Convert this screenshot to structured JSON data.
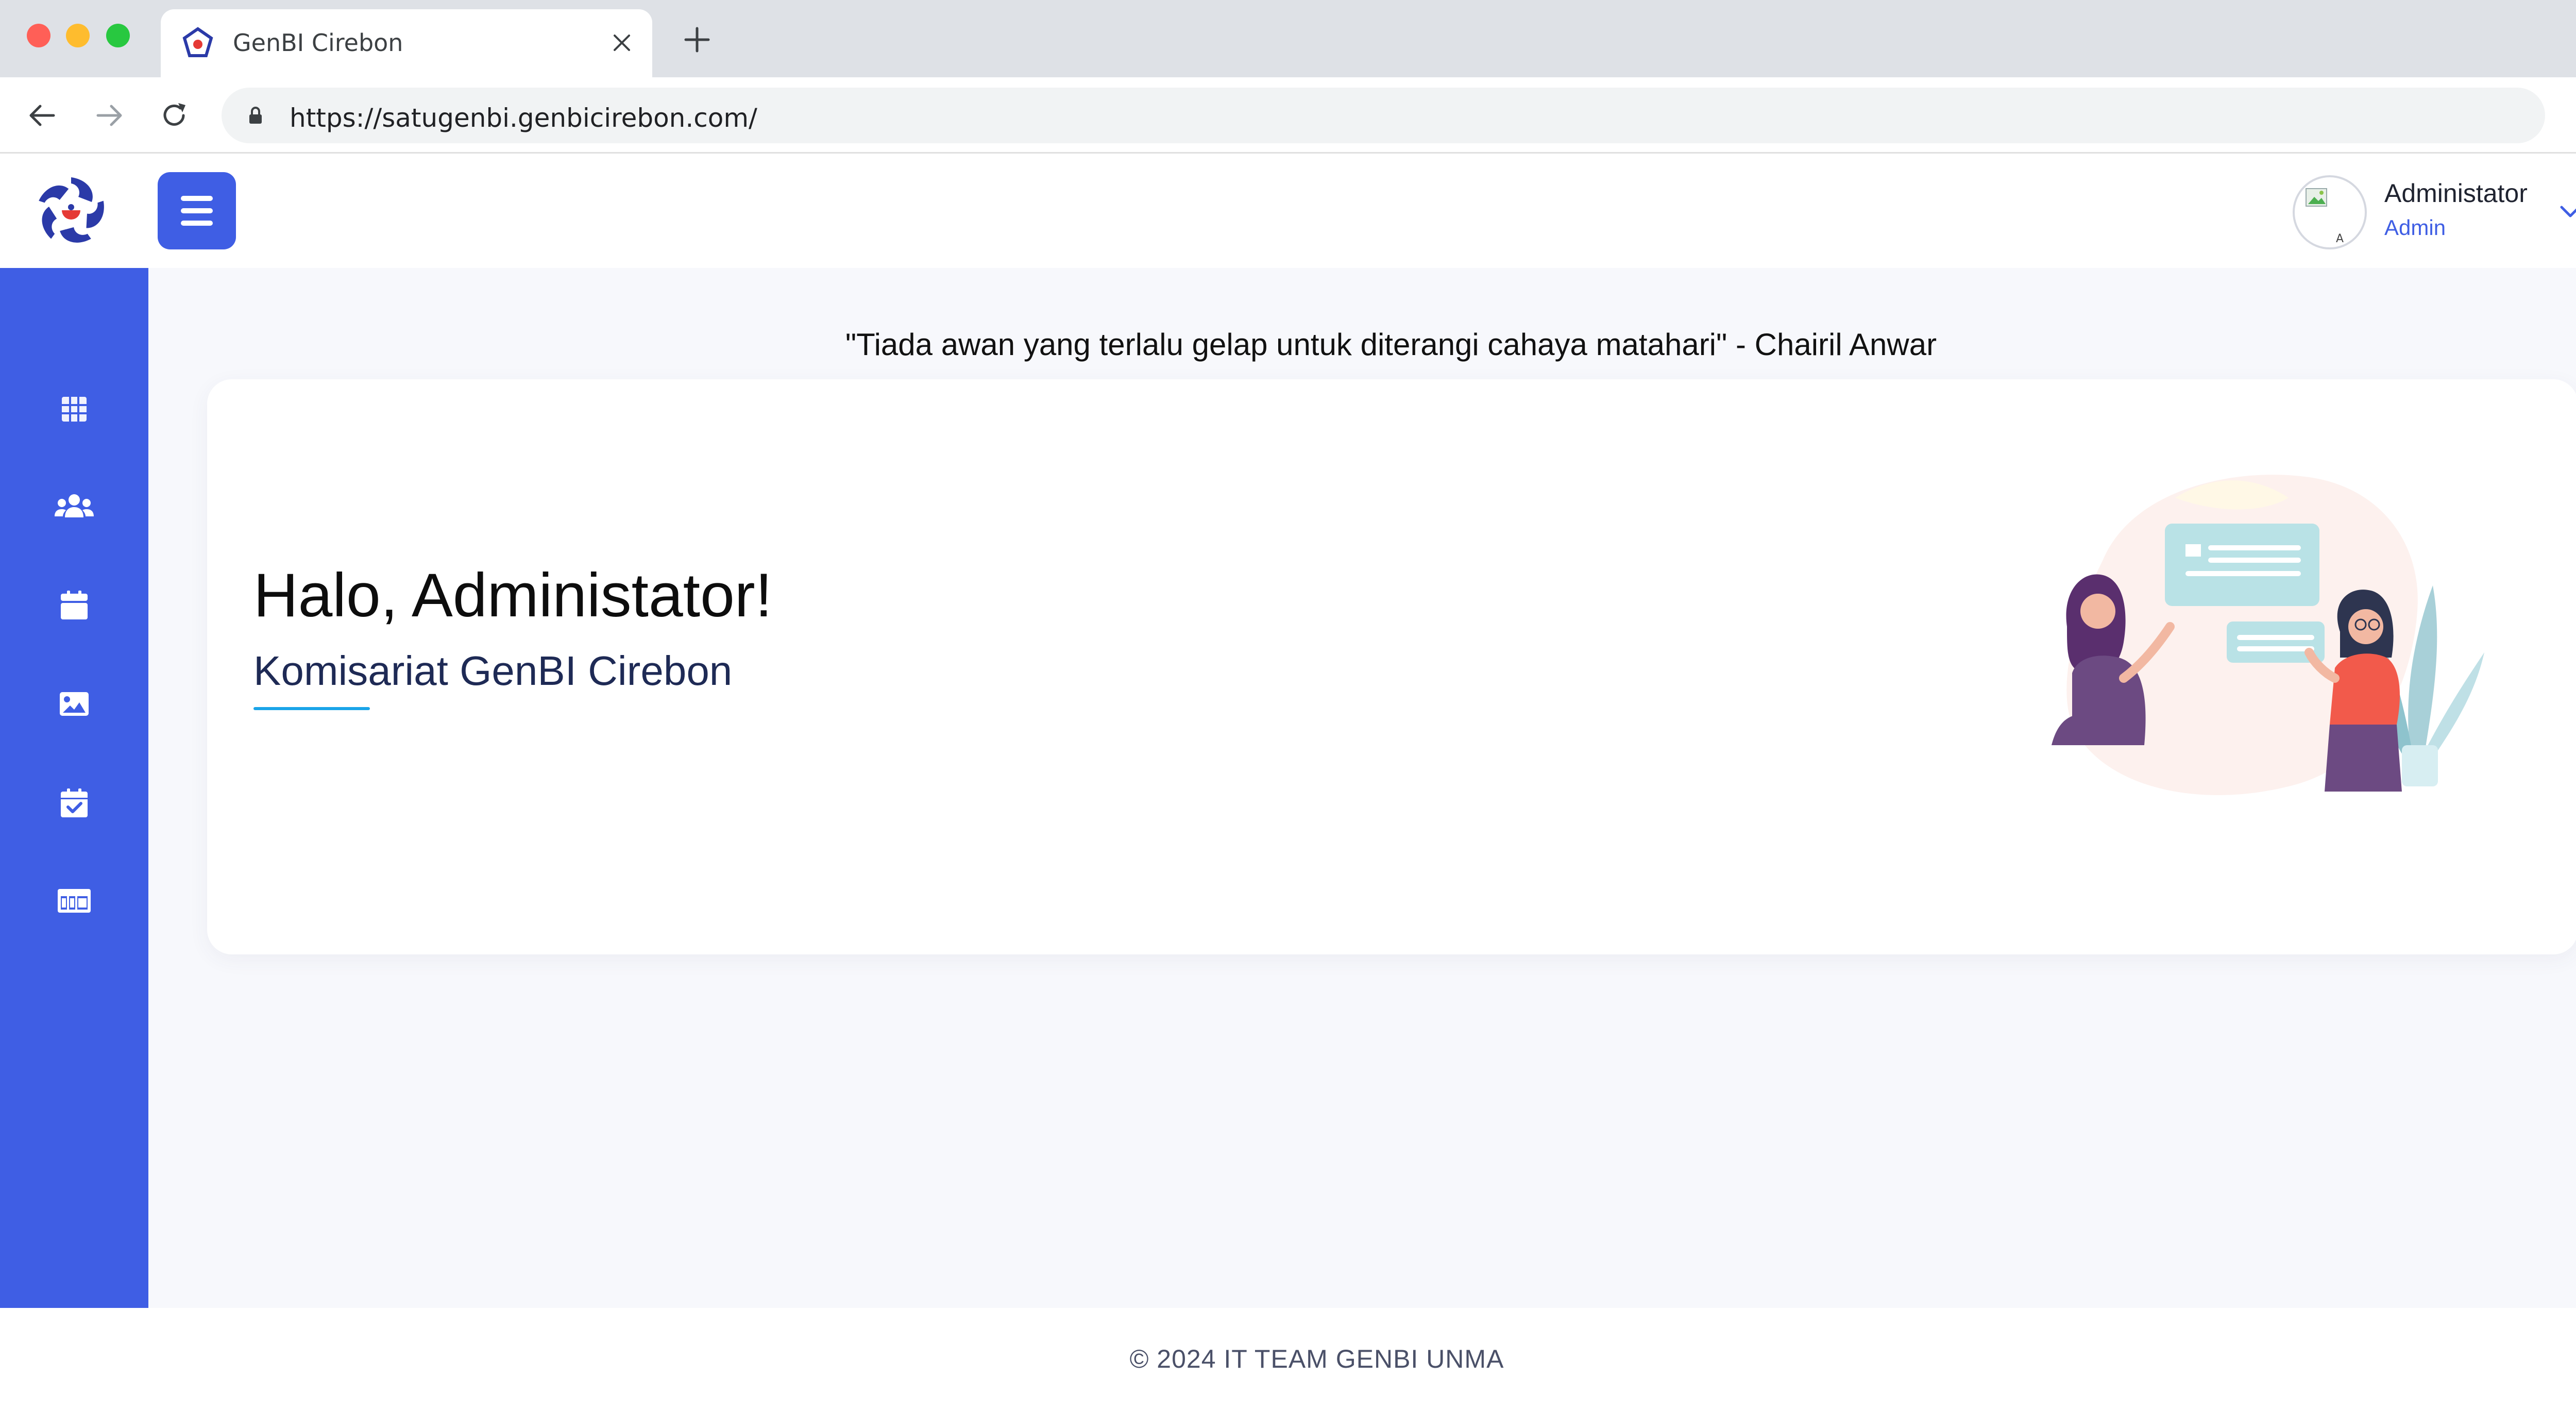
{
  "browser": {
    "tab_title": "GenBI Cirebon",
    "url": "https://satugenbi.genbicirebon.com/"
  },
  "header": {
    "user_name": "Administator",
    "user_role": "Admin"
  },
  "sidebar": {
    "items": [
      {
        "icon": "dashboard-grid-icon"
      },
      {
        "icon": "users-group-icon"
      },
      {
        "icon": "calendar-icon"
      },
      {
        "icon": "image-gallery-icon"
      },
      {
        "icon": "calendar-check-icon"
      },
      {
        "icon": "table-icon"
      }
    ]
  },
  "main": {
    "quote": "\"Tiada awan yang terlalu gelap untuk diterangi cahaya matahari\" - Chairil Anwar",
    "greeting": "Halo, Administator!",
    "organization": "Komisariat GenBI Cirebon"
  },
  "footer": {
    "copyright": "© 2024 IT TEAM GENBI UNMA"
  },
  "colors": {
    "primary": "#3f5ee4",
    "accent_underline": "#1aa4e8",
    "background": "#f7f8fc"
  }
}
